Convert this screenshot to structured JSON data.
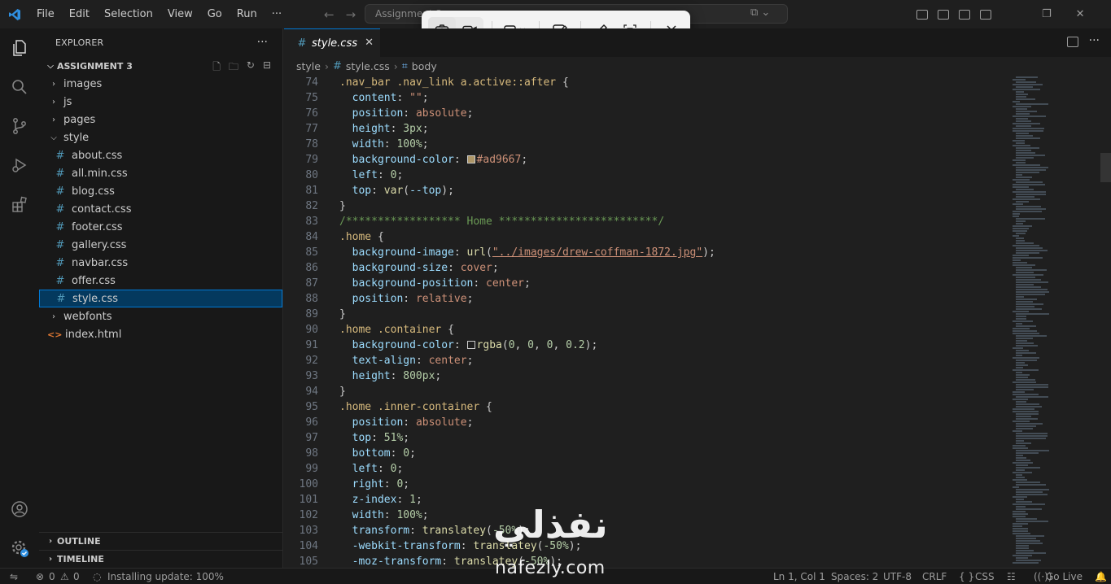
{
  "titlebar": {
    "menu": [
      "File",
      "Edit",
      "Selection",
      "View",
      "Go",
      "Run",
      "···"
    ],
    "command_center": "Assignment 3"
  },
  "snipping_toolbar": {
    "buttons": [
      "camera-icon",
      "video-icon",
      "rectangle-select-icon",
      "edit-icon",
      "pen-icon",
      "text-extract-icon",
      "close-icon"
    ]
  },
  "sidebar": {
    "title": "EXPLORER",
    "more": "···",
    "section": "ASSIGNMENT 3",
    "tree": [
      {
        "label": "images",
        "type": "folder",
        "open": false,
        "indent": 1
      },
      {
        "label": "js",
        "type": "folder",
        "open": false,
        "indent": 1
      },
      {
        "label": "pages",
        "type": "folder",
        "open": false,
        "indent": 1
      },
      {
        "label": "style",
        "type": "folder",
        "open": true,
        "indent": 1
      },
      {
        "label": "about.css",
        "type": "css",
        "indent": 2
      },
      {
        "label": "all.min.css",
        "type": "css",
        "indent": 2
      },
      {
        "label": "blog.css",
        "type": "css",
        "indent": 2
      },
      {
        "label": "contact.css",
        "type": "css",
        "indent": 2
      },
      {
        "label": "footer.css",
        "type": "css",
        "indent": 2
      },
      {
        "label": "gallery.css",
        "type": "css",
        "indent": 2
      },
      {
        "label": "navbar.css",
        "type": "css",
        "indent": 2
      },
      {
        "label": "offer.css",
        "type": "css",
        "indent": 2
      },
      {
        "label": "style.css",
        "type": "css",
        "indent": 2,
        "selected": true
      },
      {
        "label": "webfonts",
        "type": "folder",
        "open": false,
        "indent": 1
      },
      {
        "label": "index.html",
        "type": "html",
        "indent": 1
      }
    ],
    "outline": "OUTLINE",
    "timeline": "TIMELINE"
  },
  "editor": {
    "tab": "style.css",
    "breadcrumb": [
      "style",
      "style.css",
      "body"
    ],
    "lines": [
      {
        "n": "74",
        "html": "<span class='sel'>.nav_bar .nav_link a.active::after</span> <span class='punc'>{</span>"
      },
      {
        "n": "75",
        "html": "  <span class='prop'>content</span><span class='punc'>: </span><span class='val'>\"\"</span><span class='punc'>;</span>"
      },
      {
        "n": "76",
        "html": "  <span class='prop'>position</span><span class='punc'>: </span><span class='val'>absolute</span><span class='punc'>;</span>"
      },
      {
        "n": "77",
        "html": "  <span class='prop'>height</span><span class='punc'>: </span><span class='num'>3px</span><span class='punc'>;</span>"
      },
      {
        "n": "78",
        "html": "  <span class='prop'>width</span><span class='punc'>: </span><span class='num'>100%</span><span class='punc'>;</span>"
      },
      {
        "n": "79",
        "html": "  <span class='prop'>background-color</span><span class='punc'>: </span><span class='swatch' style='background:#ad9667'></span><span class='val'>#ad9667</span><span class='punc'>;</span>"
      },
      {
        "n": "80",
        "html": "  <span class='prop'>left</span><span class='punc'>: </span><span class='num'>0</span><span class='punc'>;</span>"
      },
      {
        "n": "81",
        "html": "  <span class='prop'>top</span><span class='punc'>: </span><span class='fn'>var</span><span class='punc'>(</span><span class='prop'>--top</span><span class='punc'>);</span>"
      },
      {
        "n": "82",
        "html": "<span class='punc'>}</span>"
      },
      {
        "n": "83",
        "html": "<span class='cmt'>/****************** Home *************************/</span>"
      },
      {
        "n": "84",
        "html": "<span class='sel'>.home</span> <span class='punc'>{</span>"
      },
      {
        "n": "85",
        "html": "  <span class='prop'>background-image</span><span class='punc'>: </span><span class='fn'>url</span><span class='punc'>(</span><span class='link'>\"../images/drew-coffman-1872.jpg\"</span><span class='punc'>);</span>"
      },
      {
        "n": "86",
        "html": "  <span class='prop'>background-size</span><span class='punc'>: </span><span class='val'>cover</span><span class='punc'>;</span>"
      },
      {
        "n": "87",
        "html": "  <span class='prop'>background-position</span><span class='punc'>: </span><span class='val'>center</span><span class='punc'>;</span>"
      },
      {
        "n": "88",
        "html": "  <span class='prop'>position</span><span class='punc'>: </span><span class='val'>relative</span><span class='punc'>;</span>"
      },
      {
        "n": "89",
        "html": "<span class='punc'>}</span>"
      },
      {
        "n": "90",
        "html": "<span class='sel'>.home .container</span> <span class='punc'>{</span>"
      },
      {
        "n": "91",
        "html": "  <span class='prop'>background-color</span><span class='punc'>: </span><span class='swatch' style='background:#1f1f1f'></span><span class='fn'>rgba</span><span class='punc'>(</span><span class='num'>0</span><span class='punc'>, </span><span class='num'>0</span><span class='punc'>, </span><span class='num'>0</span><span class='punc'>, </span><span class='num'>0.2</span><span class='punc'>);</span>"
      },
      {
        "n": "92",
        "html": "  <span class='prop'>text-align</span><span class='punc'>: </span><span class='val'>center</span><span class='punc'>;</span>"
      },
      {
        "n": "93",
        "html": "  <span class='prop'>height</span><span class='punc'>: </span><span class='num'>800px</span><span class='punc'>;</span>"
      },
      {
        "n": "94",
        "html": "<span class='punc'>}</span>"
      },
      {
        "n": "95",
        "html": "<span class='sel'>.home .inner-container</span> <span class='punc'>{</span>"
      },
      {
        "n": "96",
        "html": "  <span class='prop'>position</span><span class='punc'>: </span><span class='val'>absolute</span><span class='punc'>;</span>"
      },
      {
        "n": "97",
        "html": "  <span class='prop'>top</span><span class='punc'>: </span><span class='num'>51%</span><span class='punc'>;</span>"
      },
      {
        "n": "98",
        "html": "  <span class='prop'>bottom</span><span class='punc'>: </span><span class='num'>0</span><span class='punc'>;</span>"
      },
      {
        "n": "99",
        "html": "  <span class='prop'>left</span><span class='punc'>: </span><span class='num'>0</span><span class='punc'>;</span>"
      },
      {
        "n": "100",
        "html": "  <span class='prop'>right</span><span class='punc'>: </span><span class='num'>0</span><span class='punc'>;</span>"
      },
      {
        "n": "101",
        "html": "  <span class='prop'>z-index</span><span class='punc'>: </span><span class='num'>1</span><span class='punc'>;</span>"
      },
      {
        "n": "102",
        "html": "  <span class='prop'>width</span><span class='punc'>: </span><span class='num'>100%</span><span class='punc'>;</span>"
      },
      {
        "n": "103",
        "html": "  <span class='prop'>transform</span><span class='punc'>: </span><span class='fn'>translatey</span><span class='punc'>(</span><span class='num'>-50%</span><span class='punc'>);</span>"
      },
      {
        "n": "104",
        "html": "  <span class='prop'>-webkit-transform</span><span class='punc'>: </span><span class='fn'>translatey</span><span class='punc'>(</span><span class='num'>-50%</span><span class='punc'>);</span>"
      },
      {
        "n": "105",
        "html": "  <span class='prop'>-moz-transform</span><span class='punc'>: </span><span class='fn'>translatey</span><span class='punc'>(</span><span class='num'>-50%</span><span class='punc'>);</span>"
      }
    ]
  },
  "statusbar": {
    "errors": "0",
    "warnings": "0",
    "update": "Installing update: 100%",
    "position": "Ln 1, Col 1",
    "spaces": "Spaces: 2",
    "encoding": "UTF-8",
    "eol": "CRLF",
    "braces": "{ }",
    "language": "CSS",
    "golive": "Go Live"
  },
  "watermark": {
    "arabic": "نفذلي",
    "latin": "nafezly.com"
  }
}
